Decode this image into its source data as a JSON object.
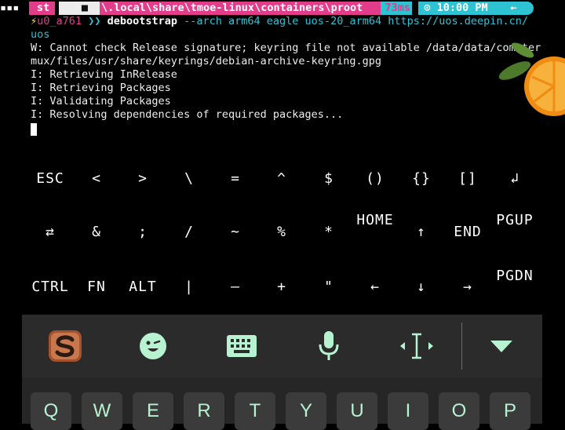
{
  "prompt": {
    "user_segment": "st",
    "path": "\\.local\\share\\tmoe-linux\\containers\\proot",
    "duration": "73ms",
    "clock": "⊙ 10:00 PM",
    "arrow": "←"
  },
  "terminal": {
    "cmd_user": "u0_a761",
    "chevron": "❯❯",
    "cmd": "debootstrap",
    "args": " --arch arm64 eagle uos-20_arm64 https://uos.deepin.cn/",
    "line_cont": "uos",
    "lines": [
      "W: Cannot check Release signature; keyring file not available /data/data/com.ter",
      "mux/files/usr/share/keyrings/debian-archive-keyring.gpg",
      "I: Retrieving InRelease",
      "I: Retrieving Packages",
      "I: Validating Packages",
      "I: Resolving dependencies of required packages..."
    ]
  },
  "extra_keys": {
    "row1": [
      "ESC",
      "<",
      ">",
      "\\",
      "=",
      "^",
      "$",
      "()",
      "{}",
      "[]",
      "↲"
    ],
    "row2": [
      "⇄",
      "&",
      ";",
      "/",
      "~",
      "%",
      "*",
      "HOME",
      "↑",
      "END",
      "PGUP"
    ],
    "row3": [
      "CTRL",
      "FN",
      "ALT",
      "|",
      "—",
      "+",
      "\"",
      "←",
      "↓",
      "→",
      "PGDN"
    ]
  },
  "toolbar": {
    "icons": [
      "swype-logo-icon",
      "emoji-wink-icon",
      "keyboard-icon",
      "microphone-icon",
      "text-cursor-icon",
      "collapse-chevron-icon"
    ]
  },
  "keyboard": {
    "keys": [
      "Q",
      "W",
      "E",
      "R",
      "T",
      "Y",
      "U",
      "I",
      "O",
      "P"
    ]
  },
  "colors": {
    "accent_pink": "#e23c8b",
    "accent_cyan": "#2ec3d3",
    "key_icon_green": "#b7f2d1"
  }
}
